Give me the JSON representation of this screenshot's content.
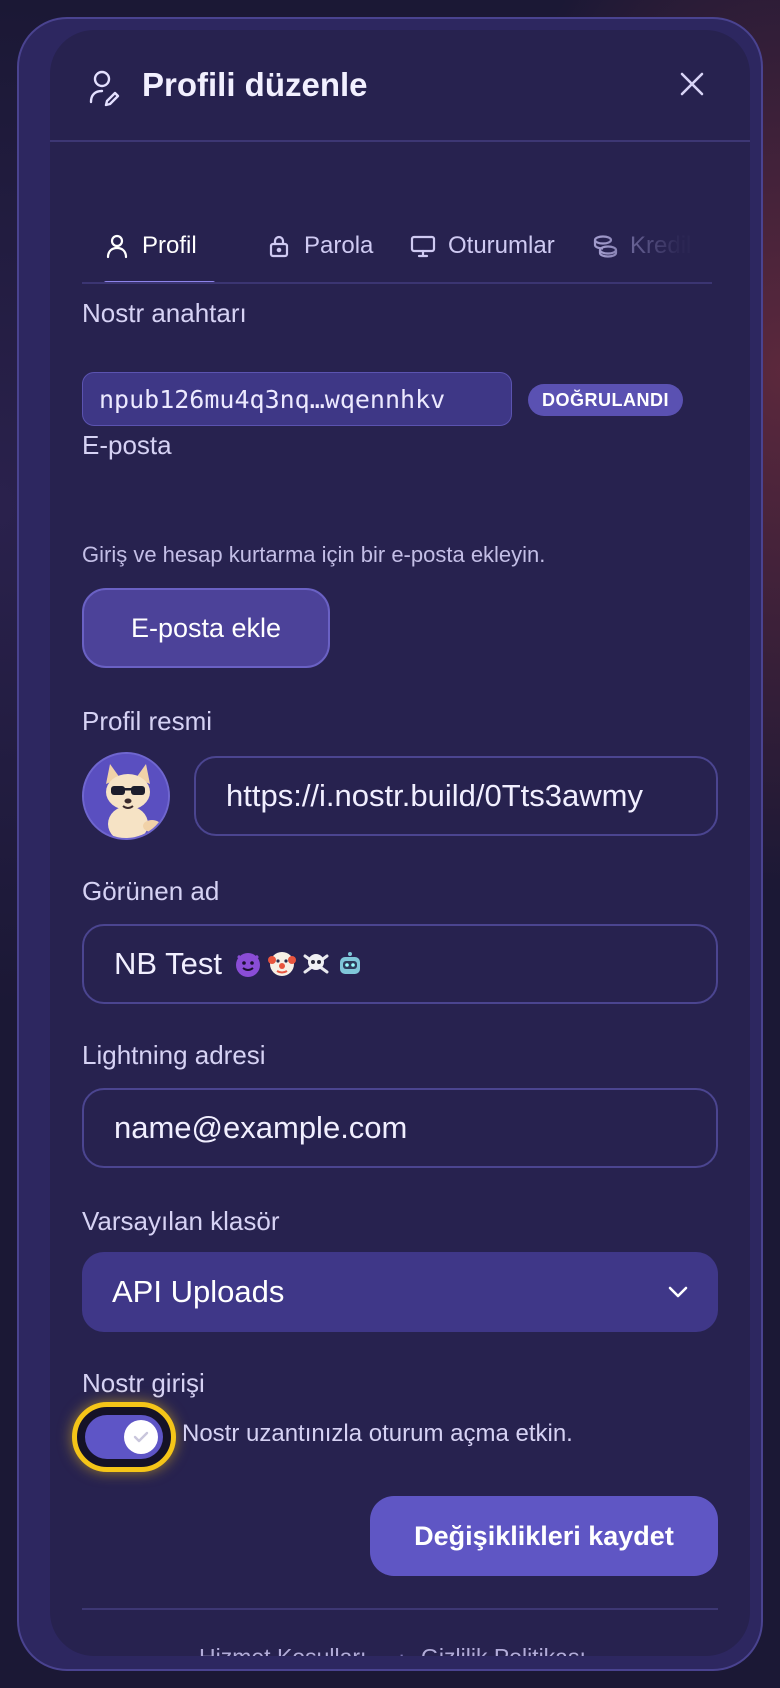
{
  "header": {
    "title": "Profili düzenle",
    "icon": "user-edit-icon",
    "close_icon": "close-icon"
  },
  "tabs": [
    {
      "label": "Profil",
      "icon": "user-icon",
      "active": true
    },
    {
      "label": "Parola",
      "icon": "lock-icon",
      "active": false
    },
    {
      "label": "Oturumlar",
      "icon": "monitor-icon",
      "active": false
    },
    {
      "label": "Kredil",
      "icon": "coins-icon",
      "active": false
    }
  ],
  "nostr_key": {
    "label": "Nostr anahtarı",
    "value": "npub126mu4q3nq…wqennhkv",
    "badge": "DOĞRULANDI"
  },
  "email": {
    "label": "E-posta",
    "helper": "Giriş ve hesap kurtarma için bir e-posta ekleyin.",
    "button": "E-posta ekle"
  },
  "profile_image": {
    "label": "Profil resmi",
    "url": "https://i.nostr.build/0Tts3awmy"
  },
  "display_name": {
    "label": "Görünen ad",
    "value": "NB Test"
  },
  "lightning": {
    "label": "Lightning adresi",
    "placeholder": "name@example.com"
  },
  "default_folder": {
    "label": "Varsayılan klasör",
    "value": "API Uploads"
  },
  "nostr_login": {
    "label": "Nostr girişi",
    "enabled": true,
    "text": "Nostr uzantınızla oturum açma etkin."
  },
  "save_button": "Değişiklikleri kaydet",
  "footer": {
    "terms": "Hizmet Koşulları",
    "separator": "·",
    "privacy": "Gizlilik Politikası"
  },
  "colors": {
    "accent": "#5f56c4",
    "focus_ring": "#f5c518",
    "background": "#27224f"
  }
}
